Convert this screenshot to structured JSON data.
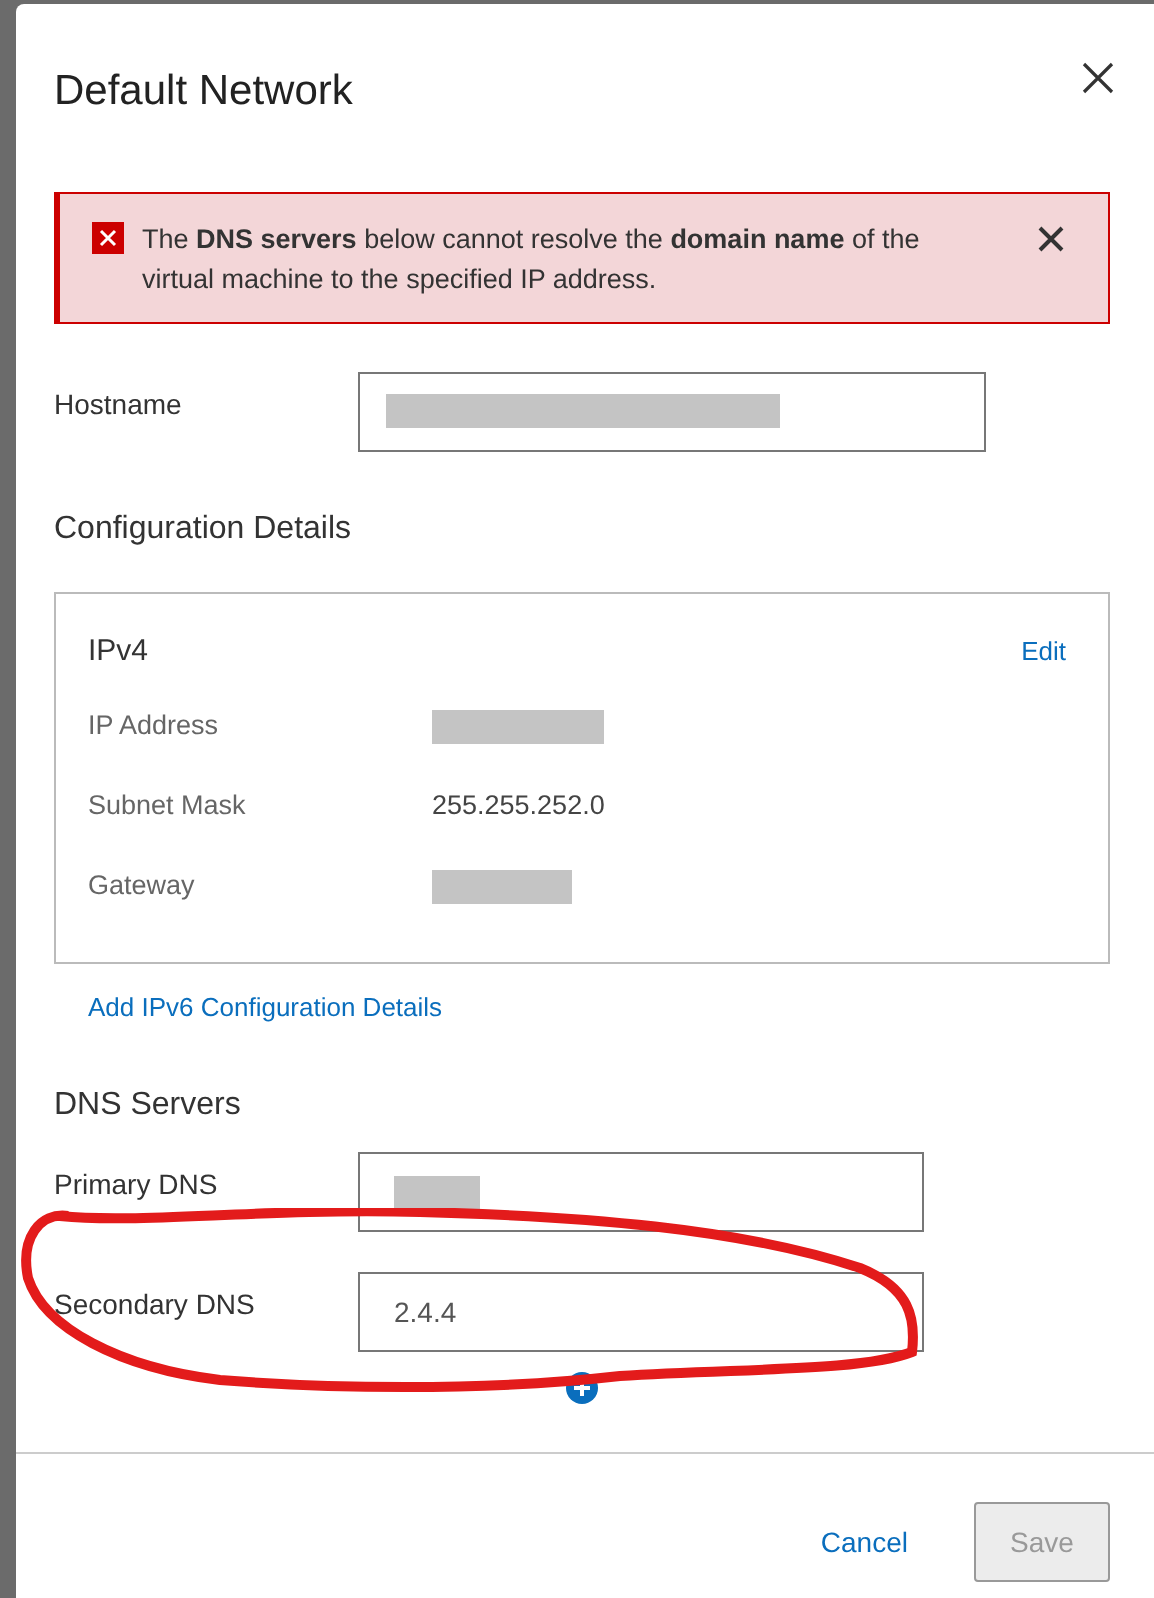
{
  "dialog": {
    "title": "Default Network"
  },
  "alert": {
    "message": "The **DNS servers** below cannot resolve the **domain name** of the virtual machine to the specified IP address."
  },
  "hostname": {
    "label": "Hostname",
    "redacted": true
  },
  "configuration": {
    "heading": "Configuration Details",
    "card_title": "IPv4",
    "edit_link": "Edit",
    "rows": [
      {
        "label": "IP Address",
        "redacted": true
      },
      {
        "label": "Subnet Mask",
        "value": "255.255.252.0",
        "redacted": false
      },
      {
        "label": "Gateway",
        "redacted": true
      }
    ],
    "add_link": "Add IPv6 Configuration Details"
  },
  "dns": {
    "heading": "DNS Servers",
    "fields": [
      {
        "label": "Primary DNS",
        "redacted": true
      },
      {
        "label": "Secondary DNS",
        "value": "2.4.4",
        "redacted": false
      }
    ]
  },
  "buttons": [
    {
      "label": "Cancel",
      "kind": "link",
      "disabled": false
    },
    {
      "label": "Save",
      "kind": "button",
      "disabled": true
    }
  ]
}
